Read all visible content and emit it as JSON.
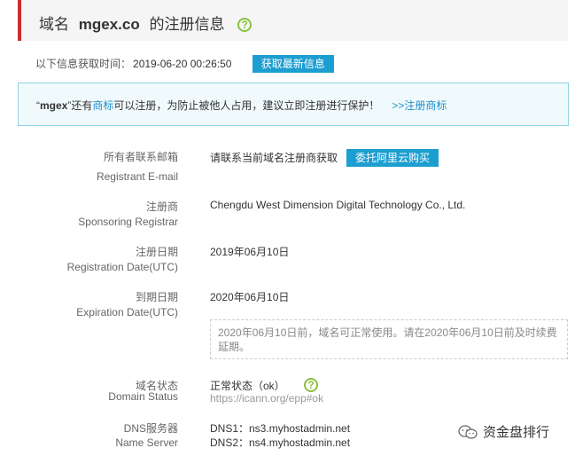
{
  "header": {
    "prefix": "域名",
    "domain": "mgex.co",
    "suffix": "的注册信息",
    "help_glyph": "?",
    "accent_color": "#c9302c"
  },
  "fetch": {
    "label": "以下信息获取时间：",
    "time": "2019-06-20 00:26:50",
    "refresh_button": "获取最新信息"
  },
  "notice": {
    "quote_open": "“",
    "name": "mgex",
    "quote_close": "”",
    "text1": "还有",
    "trademark_link": "商标",
    "text2": "可以注册，为防止被他人占用，建议立即注册进行保护！",
    "register_link": ">>注册商标"
  },
  "fields": {
    "email": {
      "label_cn": "所有者联系邮箱",
      "label_en": "Registrant E-mail",
      "value": "请联系当前域名注册商获取",
      "button": "委托阿里云购买"
    },
    "registrar": {
      "label_cn": "注册商",
      "label_en": "Sponsoring Registrar",
      "value": "Chengdu West Dimension Digital Technology Co., Ltd."
    },
    "reg_date": {
      "label_cn": "注册日期",
      "label_en": "Registration Date(UTC)",
      "value": "2019年06月10日"
    },
    "exp_date": {
      "label_cn": "到期日期",
      "label_en": "Expiration Date(UTC)",
      "value": "2020年06月10日",
      "note": "2020年06月10日前，域名可正常使用。请在2020年06月10日前及时续费延期。"
    },
    "status": {
      "label_cn": "域名状态",
      "label_en": "Domain Status",
      "value": "正常状态（ok）",
      "help_glyph": "?",
      "link": "https://icann.org/epp#ok"
    },
    "dns": {
      "label_cn": "DNS服务器",
      "label_en": "Name Server",
      "dns1": "DNS1：ns3.myhostadmin.net",
      "dns2": "DNS2：ns4.myhostadmin.net"
    }
  },
  "watermark": {
    "text": "资金盘排行"
  }
}
